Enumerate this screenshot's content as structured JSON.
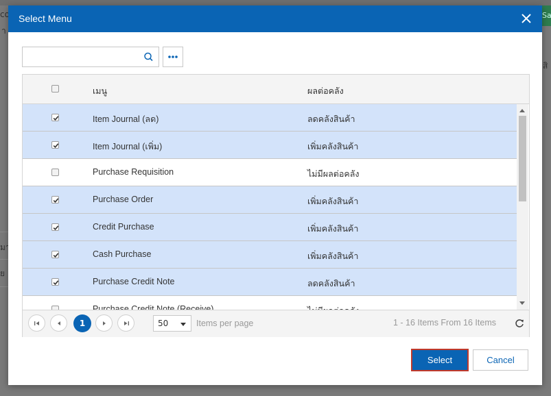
{
  "background": {
    "top_right_fragment": "Sa",
    "left_fragment_1": "co",
    "left_fragment_2": "า",
    "left_fragment_3": "มา",
    "left_fragment_4": "ย",
    "right_fragment": "สิ"
  },
  "dialog": {
    "title": "Select Menu",
    "close_icon": "close-icon"
  },
  "search": {
    "value": "",
    "placeholder": "",
    "search_icon": "search-icon",
    "more_icon": "more-icon"
  },
  "table": {
    "columns": [
      "เมนู",
      "ผลต่อคลัง"
    ],
    "rows": [
      {
        "menu": "Item Journal (ลด)",
        "result": "ลดคลังสินค้า",
        "checked": true
      },
      {
        "menu": "Item Journal (เพิ่ม)",
        "result": "เพิ่มคลังสินค้า",
        "checked": true
      },
      {
        "menu": "Purchase Requisition",
        "result": "ไม่มีผลต่อคลัง",
        "checked": false
      },
      {
        "menu": "Purchase Order",
        "result": "เพิ่มคลังสินค้า",
        "checked": true
      },
      {
        "menu": "Credit Purchase",
        "result": "เพิ่มคลังสินค้า",
        "checked": true
      },
      {
        "menu": "Cash Purchase",
        "result": "เพิ่มคลังสินค้า",
        "checked": true
      },
      {
        "menu": "Purchase Credit Note",
        "result": "ลดคลังสินค้า",
        "checked": true
      },
      {
        "menu": "Purchase Credit Note (Receive)",
        "result": "ไม่มีผลต่อคลัง",
        "checked": false
      }
    ]
  },
  "pager": {
    "current_page": "1",
    "page_size": "50",
    "items_per_page_label": "Items per page",
    "info": "1 - 16 Items From 16 Items"
  },
  "footer": {
    "select_label": "Select",
    "cancel_label": "Cancel"
  },
  "colors": {
    "header": "#0a64b4",
    "selected_row": "#d3e3fa",
    "select_border": "#c0392b"
  }
}
